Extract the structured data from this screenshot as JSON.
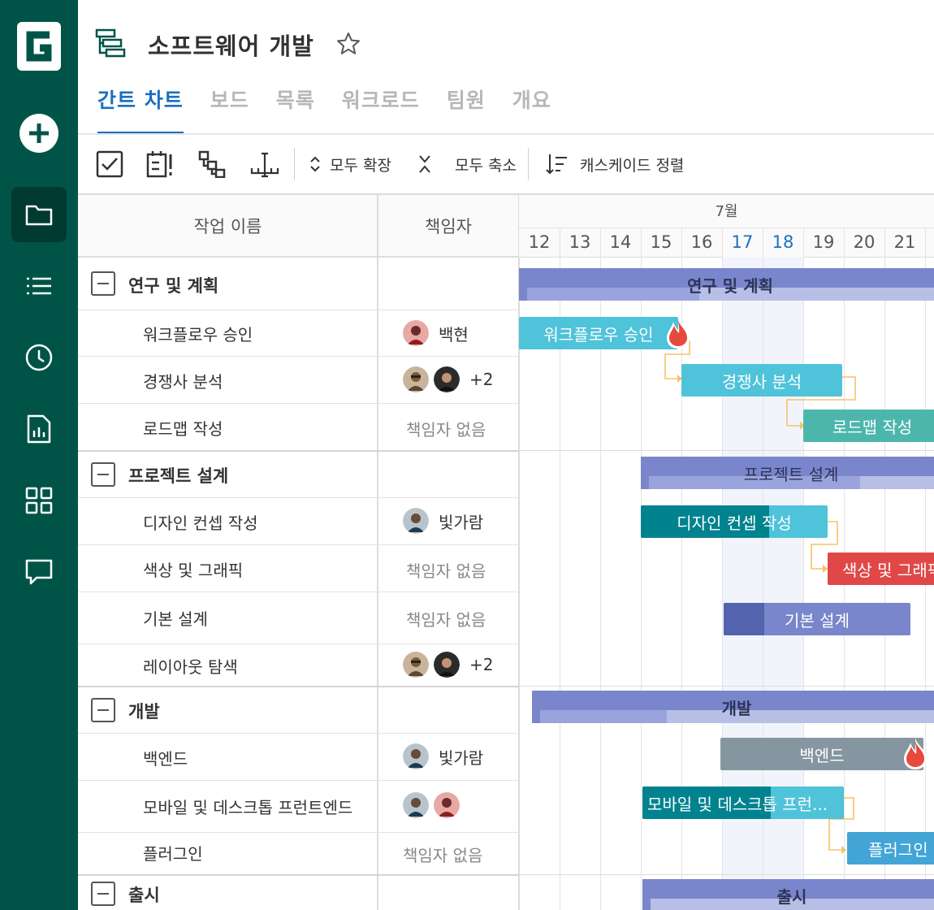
{
  "project": {
    "title": "소프트웨어 개발"
  },
  "tabs": [
    "간트 차트",
    "보드",
    "목록",
    "워크로드",
    "팀원",
    "개요"
  ],
  "toolbar": {
    "expand_all": "모두 확장",
    "collapse_all": "모두 축소",
    "cascade_sort": "캐스케이드 정렬"
  },
  "columns": {
    "task_name": "작업 이름",
    "assignee": "책임자"
  },
  "timeline": {
    "month": "7월",
    "days": [
      "12",
      "13",
      "14",
      "15",
      "16",
      "17",
      "18",
      "19",
      "20",
      "21"
    ],
    "highlight_days": [
      "17",
      "18"
    ]
  },
  "groups": [
    {
      "name": "연구 및 계획",
      "tasks": [
        {
          "name": "워크플로우 승인",
          "assignee": "백현"
        },
        {
          "name": "경쟁사 분석",
          "assignee_extra": "+2"
        },
        {
          "name": "로드맵 작성",
          "assignee": "책임자 없음"
        }
      ]
    },
    {
      "name": "프로젝트 설계",
      "tasks": [
        {
          "name": "디자인 컨셉 작성",
          "assignee": "빛가람"
        },
        {
          "name": "색상 및 그래픽",
          "assignee": "책임자 없음"
        },
        {
          "name": "기본 설계",
          "assignee": "책임자 없음"
        },
        {
          "name": "레이아웃 탐색",
          "assignee_extra": "+2"
        }
      ]
    },
    {
      "name": "개발",
      "tasks": [
        {
          "name": "백엔드",
          "assignee": "빛가람"
        },
        {
          "name": "모바일 및 데스크톱 프런트엔드"
        },
        {
          "name": "플러그인",
          "assignee": "책임자 없음"
        }
      ]
    },
    {
      "name": "출시",
      "tasks": []
    }
  ],
  "bars": {
    "g1": "연구 및 계획",
    "t1": "워크플로우 승인",
    "t2": "경쟁사 분석",
    "t3": "로드맵 작성",
    "g2": "프로젝트 설계",
    "t4": "디자인 컨셉 작성",
    "t5": "색상 및 그래픽",
    "t6": "기본 설계",
    "g3": "개발",
    "t7": "백엔드",
    "t8": "모바일 및 데스크톱 프런...",
    "t9": "플러그인",
    "g4": "출시"
  },
  "colors": {
    "sidebar": "#005447",
    "accent": "#1a6fbf",
    "group_bar": "#7a86cc",
    "teal": "#4fc3d9",
    "green": "#4db6ac",
    "dark_teal": "#00838f",
    "red": "#e04848",
    "indigo": "#7986cb",
    "gray": "#8596a0",
    "blue": "#42a5d6"
  }
}
